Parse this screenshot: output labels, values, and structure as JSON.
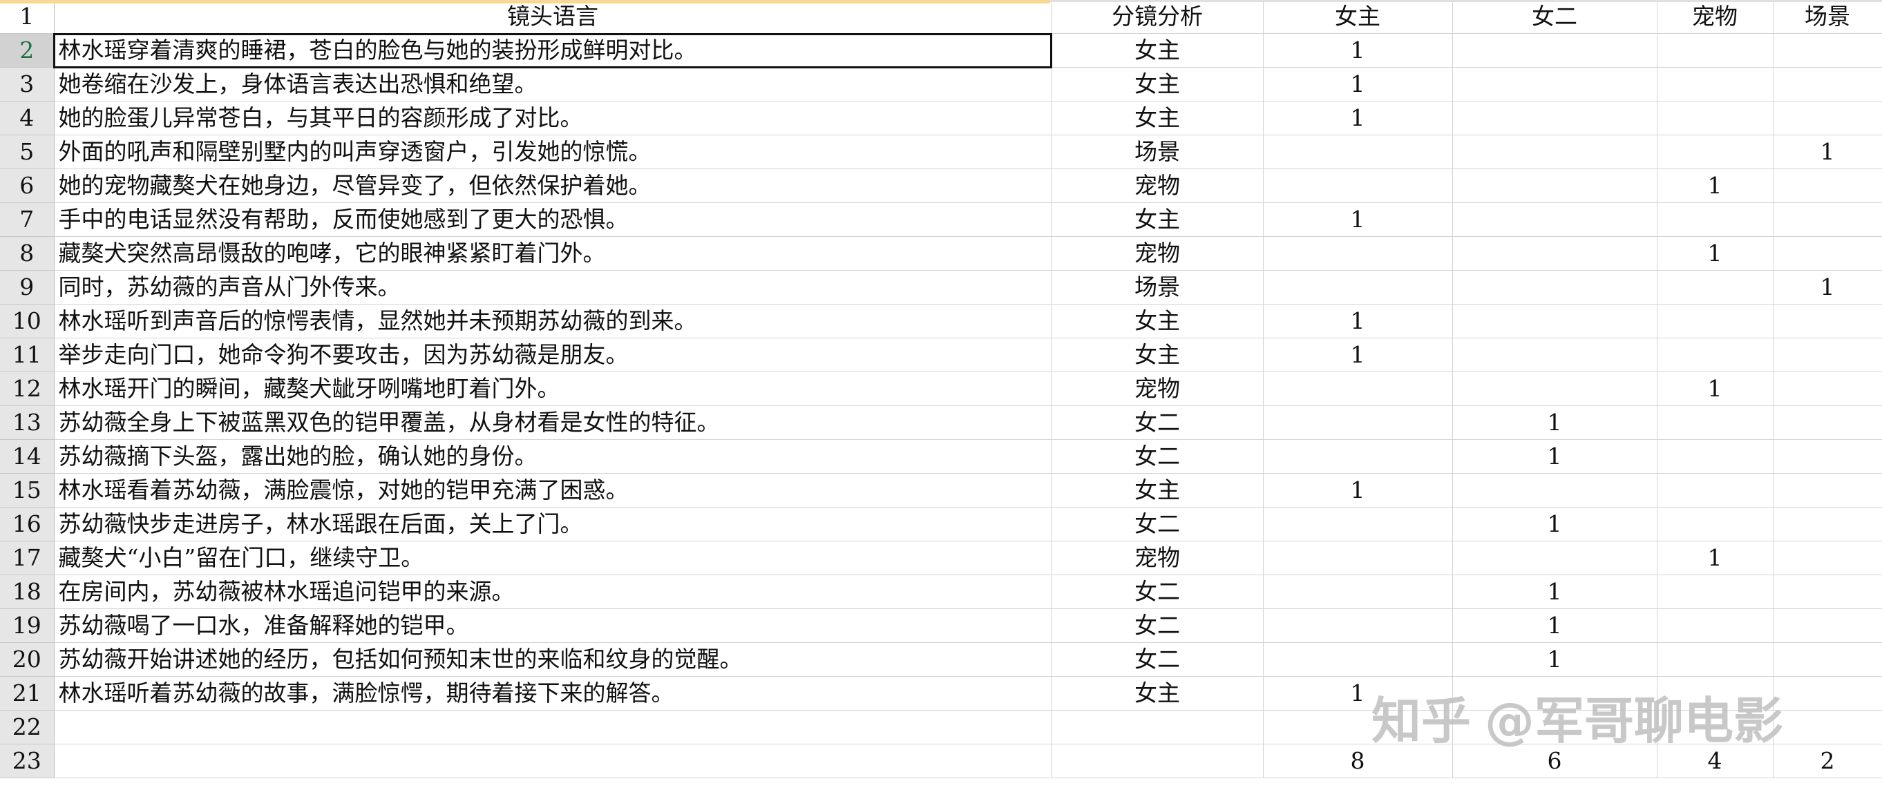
{
  "sheet": {
    "headers": {
      "row_num": "1",
      "a": "镜头语言",
      "b": "分镜分析",
      "c": "女主",
      "d": "女二",
      "e": "宠物",
      "f": "场景"
    },
    "rows": [
      {
        "n": "2",
        "a": "林水瑶穿着清爽的睡裙，苍白的脸色与她的装扮形成鲜明对比。",
        "b": "女主",
        "c": "1",
        "d": "",
        "e": "",
        "f": ""
      },
      {
        "n": "3",
        "a": "她卷缩在沙发上，身体语言表达出恐惧和绝望。",
        "b": "女主",
        "c": "1",
        "d": "",
        "e": "",
        "f": ""
      },
      {
        "n": "4",
        "a": "她的脸蛋儿异常苍白，与其平日的容颜形成了对比。",
        "b": "女主",
        "c": "1",
        "d": "",
        "e": "",
        "f": ""
      },
      {
        "n": "5",
        "a": "外面的吼声和隔壁别墅内的叫声穿透窗户，引发她的惊慌。",
        "b": "场景",
        "c": "",
        "d": "",
        "e": "",
        "f": "1"
      },
      {
        "n": "6",
        "a": "她的宠物藏獒犬在她身边，尽管异变了，但依然保护着她。",
        "b": "宠物",
        "c": "",
        "d": "",
        "e": "1",
        "f": ""
      },
      {
        "n": "7",
        "a": "手中的电话显然没有帮助，反而使她感到了更大的恐惧。",
        "b": "女主",
        "c": "1",
        "d": "",
        "e": "",
        "f": ""
      },
      {
        "n": "8",
        "a": "藏獒犬突然高昂慑敌的咆哮，它的眼神紧紧盯着门外。",
        "b": "宠物",
        "c": "",
        "d": "",
        "e": "1",
        "f": ""
      },
      {
        "n": "9",
        "a": "同时，苏幼薇的声音从门外传来。",
        "b": "场景",
        "c": "",
        "d": "",
        "e": "",
        "f": "1"
      },
      {
        "n": "10",
        "a": "林水瑶听到声音后的惊愕表情，显然她并未预期苏幼薇的到来。",
        "b": "女主",
        "c": "1",
        "d": "",
        "e": "",
        "f": ""
      },
      {
        "n": "11",
        "a": "举步走向门口，她命令狗不要攻击，因为苏幼薇是朋友。",
        "b": "女主",
        "c": "1",
        "d": "",
        "e": "",
        "f": ""
      },
      {
        "n": "12",
        "a": "林水瑶开门的瞬间，藏獒犬龇牙咧嘴地盯着门外。",
        "b": "宠物",
        "c": "",
        "d": "",
        "e": "1",
        "f": ""
      },
      {
        "n": "13",
        "a": "苏幼薇全身上下被蓝黑双色的铠甲覆盖，从身材看是女性的特征。",
        "b": "女二",
        "c": "",
        "d": "1",
        "e": "",
        "f": ""
      },
      {
        "n": "14",
        "a": "苏幼薇摘下头盔，露出她的脸，确认她的身份。",
        "b": "女二",
        "c": "",
        "d": "1",
        "e": "",
        "f": ""
      },
      {
        "n": "15",
        "a": "林水瑶看着苏幼薇，满脸震惊，对她的铠甲充满了困惑。",
        "b": "女主",
        "c": "1",
        "d": "",
        "e": "",
        "f": ""
      },
      {
        "n": "16",
        "a": "苏幼薇快步走进房子，林水瑶跟在后面，关上了门。",
        "b": "女二",
        "c": "",
        "d": "1",
        "e": "",
        "f": ""
      },
      {
        "n": "17",
        "a": "藏獒犬“小白”留在门口，继续守卫。",
        "b": "宠物",
        "c": "",
        "d": "",
        "e": "1",
        "f": ""
      },
      {
        "n": "18",
        "a": "在房间内，苏幼薇被林水瑶追问铠甲的来源。",
        "b": "女二",
        "c": "",
        "d": "1",
        "e": "",
        "f": ""
      },
      {
        "n": "19",
        "a": "苏幼薇喝了一口水，准备解释她的铠甲。",
        "b": "女二",
        "c": "",
        "d": "1",
        "e": "",
        "f": ""
      },
      {
        "n": "20",
        "a": "苏幼薇开始讲述她的经历，包括如何预知末世的来临和纹身的觉醒。",
        "b": "女二",
        "c": "",
        "d": "1",
        "e": "",
        "f": ""
      },
      {
        "n": "21",
        "a": "林水瑶听着苏幼薇的故事，满脸惊愕，期待着接下来的解答。",
        "b": "女主",
        "c": "1",
        "d": "",
        "e": "",
        "f": ""
      },
      {
        "n": "22",
        "a": "",
        "b": "",
        "c": "",
        "d": "",
        "e": "",
        "f": ""
      },
      {
        "n": "23",
        "a": "",
        "b": "",
        "c": "8",
        "d": "6",
        "e": "4",
        "f": "2"
      }
    ]
  },
  "watermark": {
    "brand": "知乎",
    "handle": "@军哥聊电影"
  },
  "colors": {
    "row_header_bg": "#e6e6e6",
    "selected_row_header_bg": "#d2d2d2",
    "selected_row_header_text": "#1e7145",
    "gridline": "#d4d4d4"
  }
}
